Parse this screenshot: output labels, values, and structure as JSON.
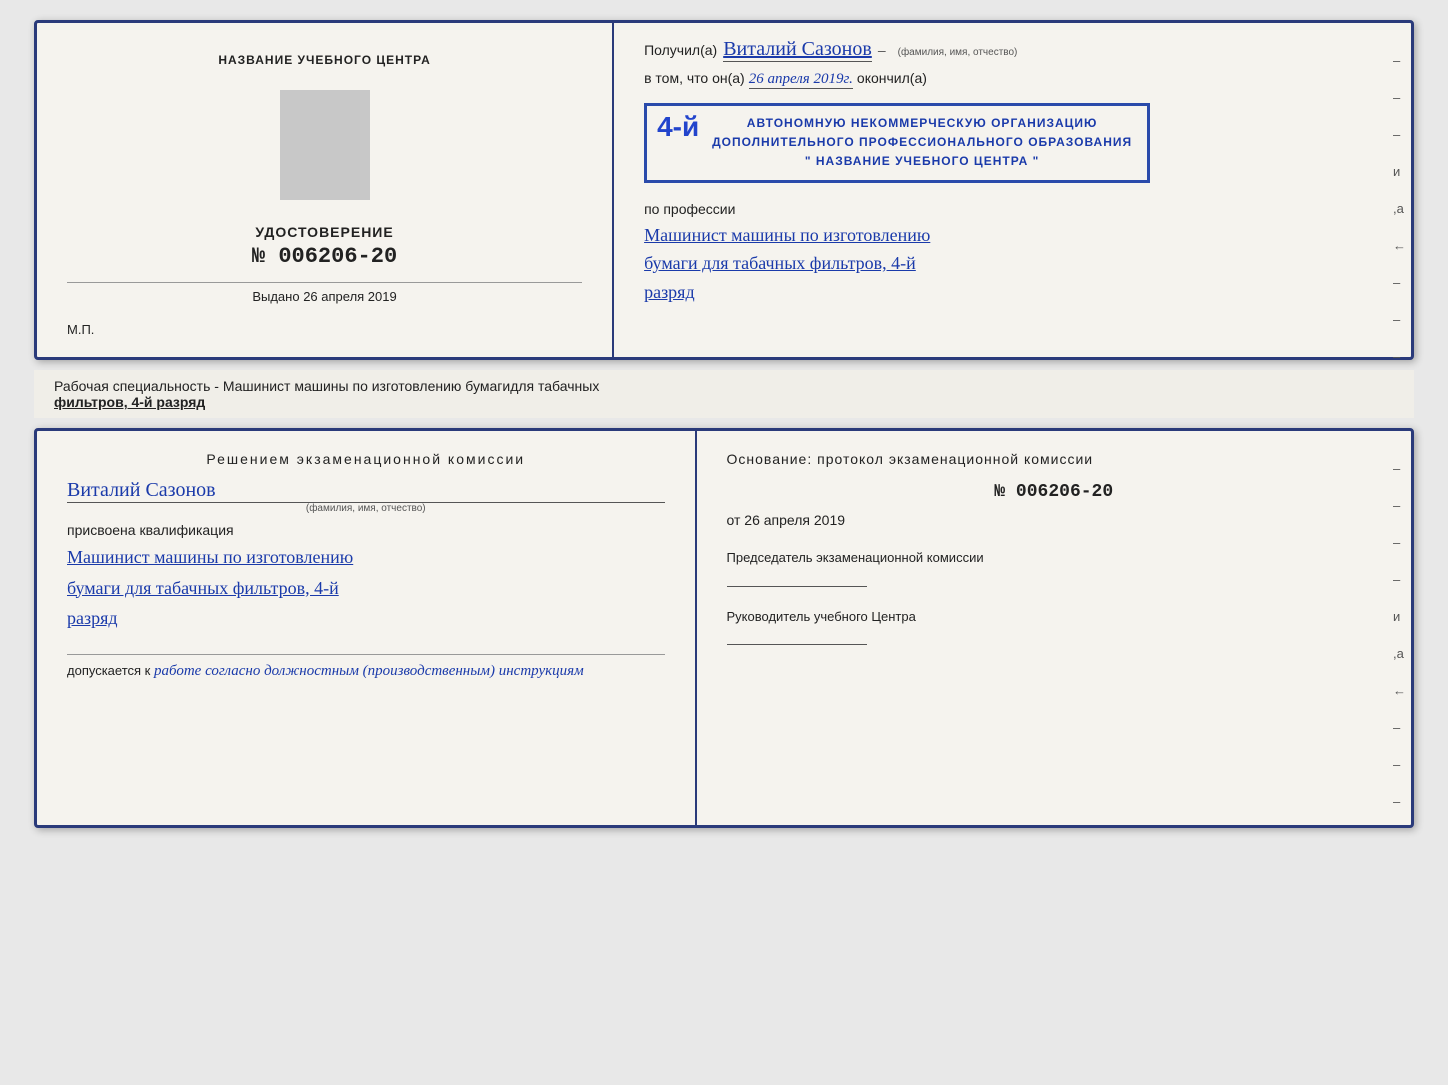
{
  "top_cert": {
    "left": {
      "center_name": "НАЗВАНИЕ УЧЕБНОГО ЦЕНТРА",
      "udostoverenie_title": "УДОСТОВЕРЕНИЕ",
      "udostoverenie_number": "№ 006206-20",
      "vydano_label": "Выдано",
      "vydano_date": "26 апреля 2019",
      "mp_label": "М.П."
    },
    "right": {
      "poluchil_prefix": "Получил(а)",
      "recipient_name": "Виталий Сазонов",
      "fio_label": "(фамилия, имя, отчество)",
      "dash": "–",
      "vtom_prefix": "в том, что он(а)",
      "date_value": "26 апреля 2019г.",
      "okonchil": "окончил(а)",
      "stamp_number": "4-й",
      "stamp_line1": "АВТОНОМНУЮ НЕКОММЕРЧЕСКУЮ ОРГАНИЗАЦИЮ",
      "stamp_line2": "ДОПОЛНИТЕЛЬНОГО ПРОФЕССИОНАЛЬНОГО ОБРАЗОВАНИЯ",
      "stamp_line3": "\" НАЗВАНИЕ УЧЕБНОГО ЦЕНТРА \"",
      "po_professii": "по профессии",
      "profession_line1": "Машинист машины по изготовлению",
      "profession_line2": "бумаги для табачных фильтров, 4-й",
      "profession_line3": "разряд"
    },
    "right_dashes": [
      "–",
      "–",
      "–",
      "и",
      ",а",
      "←",
      "–",
      "–",
      "–"
    ]
  },
  "specialty": {
    "prefix": "Рабочая специальность - Машинист машины по изготовлению бумагидля табачных",
    "underlined": "фильтров, 4-й разряд"
  },
  "bottom_cert": {
    "left": {
      "reshenie_title": "Решением экзаменационной комиссии",
      "name": "Виталий Сазонов",
      "fio_label": "(фамилия, имя, отчество)",
      "prisvoena": "присвоена квалификация",
      "qual_line1": "Машинист машины по изготовлению",
      "qual_line2": "бумаги для табачных фильтров, 4-й",
      "qual_line3": "разряд",
      "dopusk_prefix": "допускается к",
      "dopusk_text": "работе согласно должностным (производственным) инструкциям"
    },
    "right": {
      "osnovanie_title": "Основание: протокол экзаменационной комиссии",
      "protocol_number": "№ 006206-20",
      "ot_prefix": "от",
      "ot_date": "26 апреля 2019",
      "predsedatel_label": "Председатель экзаменационной комиссии",
      "rukovoditel_label": "Руководитель учебного Центра",
      "right_dashes": [
        "–",
        "–",
        "–",
        "–",
        "и",
        ",а",
        "←",
        "–",
        "–",
        "–"
      ]
    }
  }
}
